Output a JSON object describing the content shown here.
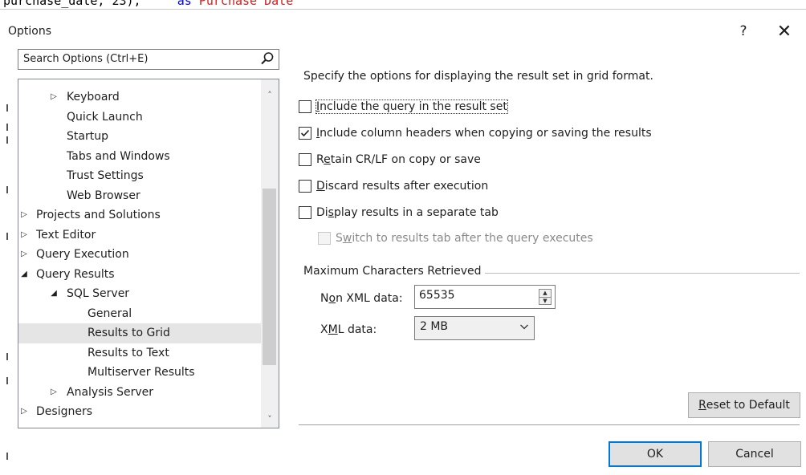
{
  "background_code": {
    "fragment_a": "purchase_date, 23),",
    "keyword": "as",
    "fragment_b": "Purchase Date",
    "colors": {
      "keyword": "#0000ff",
      "string": "#d2201c"
    }
  },
  "dialog": {
    "title": "Options",
    "help_label": "?",
    "close_label": "✕"
  },
  "search": {
    "placeholder": "Search Options (Ctrl+E)",
    "icon": "search-icon"
  },
  "tree": {
    "items": [
      {
        "label": "Keyboard",
        "arrow": "▷"
      },
      {
        "label": "Quick Launch",
        "arrow": ""
      },
      {
        "label": "Startup",
        "arrow": ""
      },
      {
        "label": "Tabs and Windows",
        "arrow": ""
      },
      {
        "label": "Trust Settings",
        "arrow": ""
      },
      {
        "label": "Web Browser",
        "arrow": ""
      },
      {
        "label": "Projects and Solutions",
        "arrow": "▷"
      },
      {
        "label": "Text Editor",
        "arrow": "▷"
      },
      {
        "label": "Query Execution",
        "arrow": "▷"
      },
      {
        "label": "Query Results",
        "arrow": "◢"
      },
      {
        "label": "SQL Server",
        "arrow": "◢"
      },
      {
        "label": "General",
        "arrow": ""
      },
      {
        "label": "Results to Grid",
        "arrow": "",
        "selected": true
      },
      {
        "label": "Results to Text",
        "arrow": ""
      },
      {
        "label": "Multiserver Results",
        "arrow": ""
      },
      {
        "label": "Analysis Server",
        "arrow": "▷"
      },
      {
        "label": "Designers",
        "arrow": "▷"
      }
    ],
    "scroll_up": "˄",
    "scroll_down": "˅"
  },
  "panel": {
    "description": "Specify the options for displaying the result set in grid format.",
    "options": [
      {
        "pre": "",
        "u": "I",
        "post": "nclude the query in the result set",
        "checked": false,
        "enabled": true
      },
      {
        "pre": "",
        "u": "I",
        "post": "nclude column headers when copying or saving the results",
        "checked": true,
        "enabled": true
      },
      {
        "pre": "R",
        "u": "e",
        "post": "tain CR/LF on copy or save",
        "checked": false,
        "enabled": true
      },
      {
        "pre": "",
        "u": "D",
        "post": "iscard results after execution",
        "checked": false,
        "enabled": true
      },
      {
        "pre": "Di",
        "u": "s",
        "post": "play results in a separate tab",
        "checked": false,
        "enabled": true
      },
      {
        "pre": "S",
        "u": "w",
        "post": "itch to results tab after the query executes",
        "checked": false,
        "enabled": false
      }
    ],
    "group_title": "Maximum Characters Retrieved",
    "non_xml": {
      "pre": "N",
      "u": "o",
      "post": "n XML data:",
      "value": "65535"
    },
    "xml": {
      "pre": "X",
      "u": "M",
      "post": "L data:",
      "value": "2 MB"
    },
    "reset": {
      "pre": "",
      "u": "R",
      "post": "eset to Default"
    }
  },
  "footer": {
    "ok_label": "OK",
    "cancel_label": "Cancel"
  },
  "colors": {
    "accent": "#0078d7",
    "selection": "#e5e5e5",
    "disabled_text": "#8a8a8a"
  }
}
